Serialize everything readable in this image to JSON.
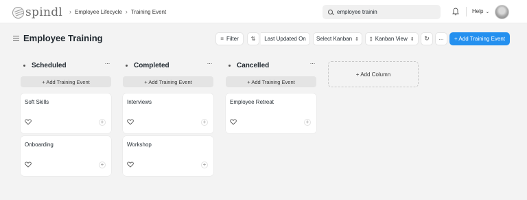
{
  "navbar": {
    "logo_text": "spindl",
    "breadcrumbs": [
      "Employee Lifecycle",
      "Training Event"
    ],
    "search_value": "employee trainin",
    "help_label": "Help"
  },
  "page": {
    "title": "Employee Training",
    "toolbar": {
      "filter_label": "Filter",
      "sort_label": "Last Updated On",
      "select_kanban_label": "Select Kanban",
      "kanban_view_label": "Kanban View",
      "more_label": "...",
      "add_label": "+ Add Training Event"
    }
  },
  "kanban": {
    "add_card_label": "+ Add Training Event",
    "add_column_label": "+ Add Column",
    "columns": [
      {
        "title": "Scheduled",
        "cards": [
          "Soft Skills",
          "Onboarding"
        ]
      },
      {
        "title": "Completed",
        "cards": [
          "Interviews",
          "Workshop"
        ]
      },
      {
        "title": "Cancelled",
        "cards": [
          "Employee Retreat"
        ]
      }
    ]
  },
  "colors": {
    "primary": "#2490ef",
    "background": "#f3f3f3",
    "card": "#ffffff"
  },
  "icons": [
    "logo-icon",
    "chevron-right-icon",
    "search-icon",
    "bell-icon",
    "chevron-down-icon",
    "avatar",
    "hamburger-icon",
    "filter-icon",
    "sort-icon",
    "up-down-icon",
    "kanban-icon",
    "refresh-icon",
    "heart-icon",
    "plus-icon",
    "dots-icon"
  ]
}
